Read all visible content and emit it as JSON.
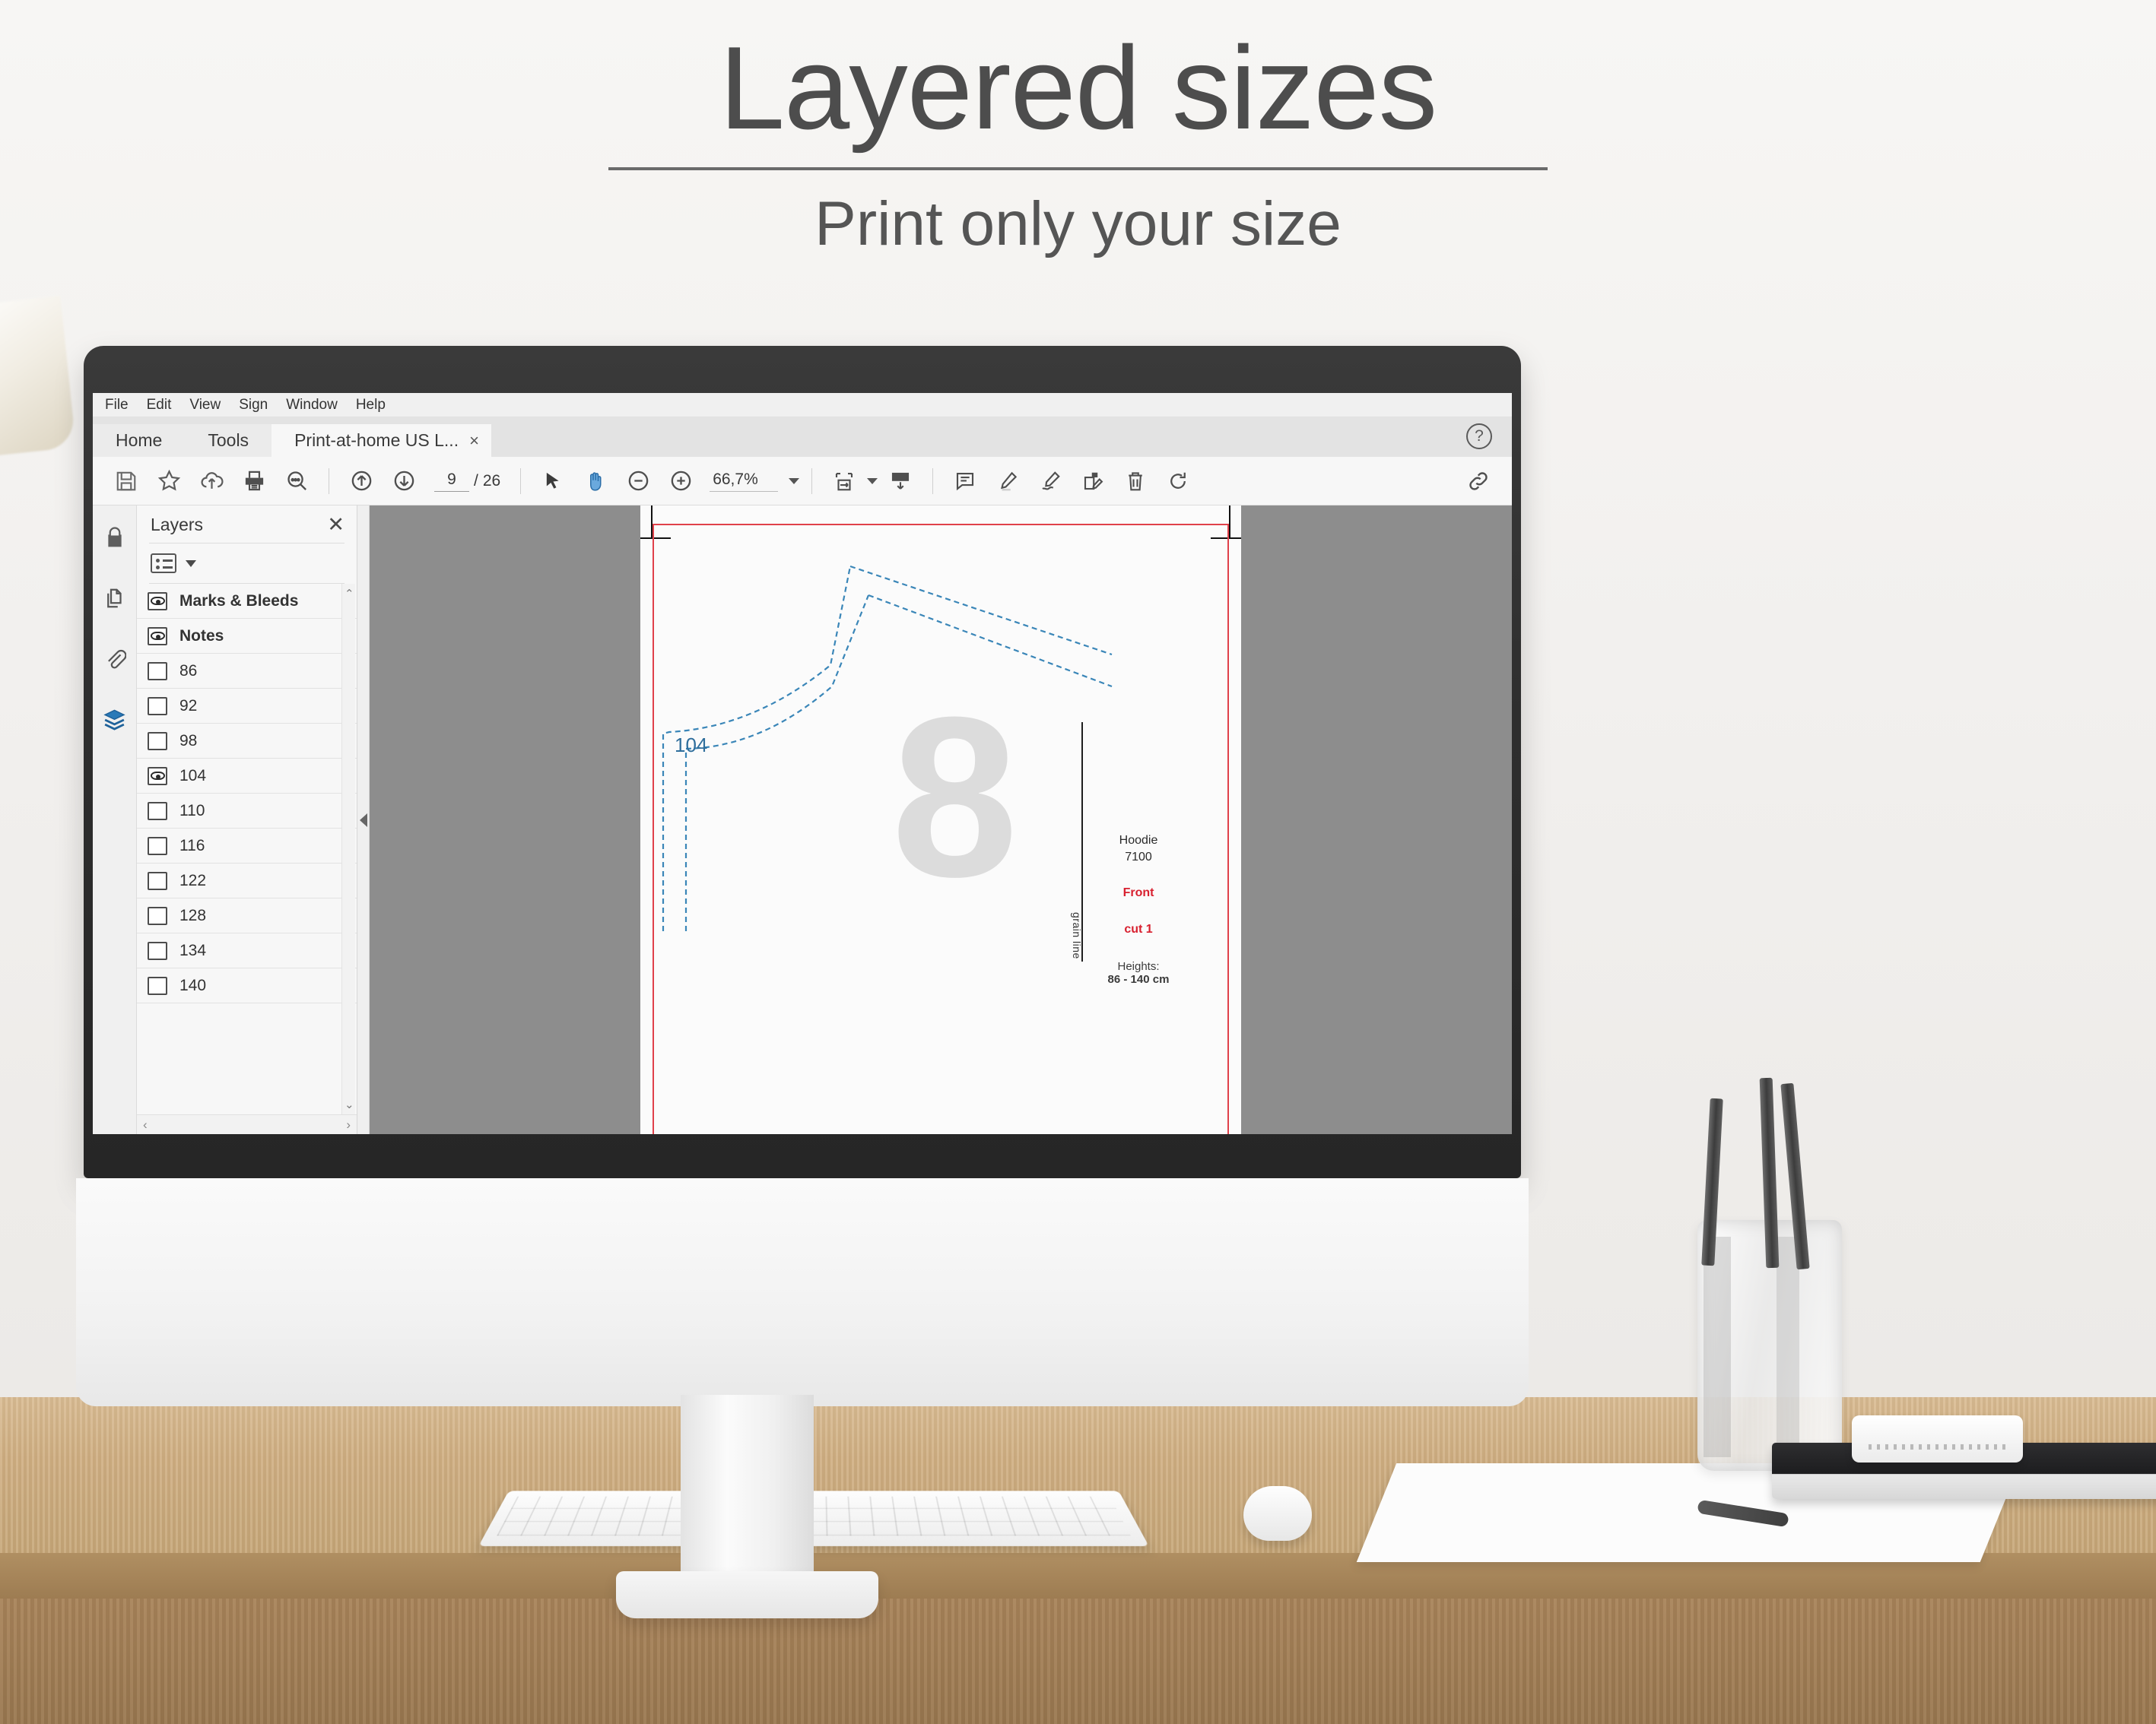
{
  "headline": {
    "title": "Layered sizes",
    "subtitle": "Print only your size"
  },
  "app": {
    "menubar": [
      "File",
      "Edit",
      "View",
      "Sign",
      "Window",
      "Help"
    ],
    "tabs": [
      {
        "label": "Home"
      },
      {
        "label": "Tools"
      },
      {
        "label": "Print-at-home US L...",
        "closable": true,
        "close_label": "×"
      }
    ],
    "help_icon_label": "?",
    "toolbar": {
      "left_icons": [
        "save-icon",
        "star-icon",
        "upload-cloud-icon",
        "print-icon",
        "search-icon"
      ],
      "nav_icons": [
        "previous-page-icon",
        "next-page-icon"
      ],
      "page_current": "9",
      "page_separator": "/",
      "page_total": "26",
      "tool_icons": [
        "select-cursor-icon",
        "hand-tool-icon",
        "zoom-out-icon",
        "zoom-in-icon"
      ],
      "zoom_level": "66,7%",
      "fit_icons": [
        "fit-page-icon",
        "scroll-mode-icon"
      ],
      "annotation_icons": [
        "comment-icon",
        "highlight-icon",
        "sign-icon",
        "fill-and-sign-icon",
        "delete-icon",
        "rotate-icon"
      ],
      "right_icons": [
        "share-link-icon"
      ]
    },
    "rail": [
      {
        "name": "security-lock-icon"
      },
      {
        "name": "page-thumbnails-icon"
      },
      {
        "name": "attachments-icon"
      },
      {
        "name": "layers-icon",
        "active": true
      }
    ],
    "layers_panel": {
      "title": "Layers",
      "close_label": "✕",
      "options_icon": "layer-options-icon",
      "items": [
        {
          "label": "Marks & Bleeds",
          "visible": true,
          "bold": true
        },
        {
          "label": "Notes",
          "visible": true,
          "bold": true
        },
        {
          "label": "86",
          "visible": false,
          "bold": false
        },
        {
          "label": "92",
          "visible": false,
          "bold": false
        },
        {
          "label": "98",
          "visible": false,
          "bold": false
        },
        {
          "label": "104",
          "visible": true,
          "bold": false
        },
        {
          "label": "110",
          "visible": false,
          "bold": false
        },
        {
          "label": "116",
          "visible": false,
          "bold": false
        },
        {
          "label": "122",
          "visible": false,
          "bold": false
        },
        {
          "label": "128",
          "visible": false,
          "bold": false
        },
        {
          "label": "134",
          "visible": false,
          "bold": false
        },
        {
          "label": "140",
          "visible": false,
          "bold": false
        }
      ],
      "scroll_up_label": "⌃",
      "scroll_down_label": "⌄",
      "scroll_left_label": "‹",
      "scroll_right_label": "›"
    },
    "splitter_icon": "collapse-panel-arrow-icon",
    "document": {
      "size_label": "104",
      "watermark": "8",
      "grain_line_label": "grain line",
      "garment_name": "Hoodie",
      "pattern_number": "7100",
      "piece_name": "Front",
      "cut_instruction": "cut 1",
      "heights_label": "Heights:",
      "heights_value": "86 - 140 cm"
    },
    "colors": {
      "accent_blue": "#2f6e9c",
      "margin_red": "#e0414a",
      "cut_red": "#d8202f",
      "layer_active": "#2a7ab8"
    }
  }
}
